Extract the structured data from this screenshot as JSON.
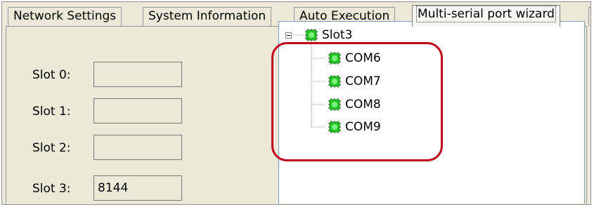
{
  "tabs": [
    {
      "label": "Network Settings",
      "active": false
    },
    {
      "label": "System Information",
      "active": false
    },
    {
      "label": "Auto Execution",
      "active": false
    },
    {
      "label": "Multi-serial port wizard",
      "active": true
    }
  ],
  "slots": [
    {
      "label": "Slot 0:",
      "value": ""
    },
    {
      "label": "Slot 1:",
      "value": ""
    },
    {
      "label": "Slot 2:",
      "value": ""
    },
    {
      "label": "Slot 3:",
      "value": "8144"
    }
  ],
  "tree": {
    "root": {
      "label": "Slot3",
      "expanded": true,
      "icon": "chip-icon"
    },
    "children": [
      {
        "label": "COM6",
        "icon": "chip-icon"
      },
      {
        "label": "COM7",
        "icon": "chip-icon"
      },
      {
        "label": "COM8",
        "icon": "chip-icon"
      },
      {
        "label": "COM9",
        "icon": "chip-icon"
      }
    ]
  },
  "colors": {
    "highlight": "#c0001a",
    "chip": "#20c020"
  }
}
